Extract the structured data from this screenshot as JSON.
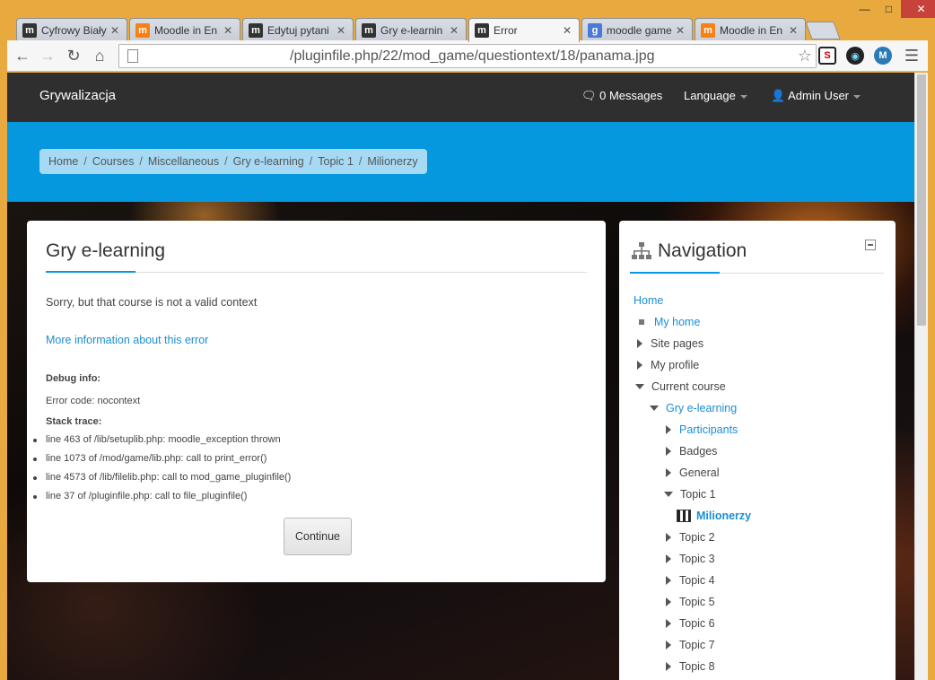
{
  "browser": {
    "tabs": [
      {
        "title": "Cyfrowy Biały",
        "favicon": "moodle-m-icon"
      },
      {
        "title": "Moodle in En",
        "favicon": "moodle-orange-icon"
      },
      {
        "title": "Edytuj pytani",
        "favicon": "moodle-m-icon"
      },
      {
        "title": "Gry e-learnin",
        "favicon": "moodle-m-icon"
      },
      {
        "title": "Error",
        "favicon": "moodle-m-icon",
        "active": true
      },
      {
        "title": "moodle game",
        "favicon": "google-icon"
      },
      {
        "title": "Moodle in En",
        "favicon": "moodle-orange-icon"
      }
    ],
    "tab_close": "✕",
    "url": "/pluginfile.php/22/mod_game/questiontext/18/panama.jpg"
  },
  "navbar": {
    "brand": "Grywalizacja",
    "messages": "0 Messages",
    "language": "Language",
    "user": "Admin User"
  },
  "breadcrumb": [
    "Home",
    "Courses",
    "Miscellaneous",
    "Gry e-learning",
    "Topic 1",
    "Milionerzy"
  ],
  "breadcrumb_sep": "/",
  "main": {
    "title": "Gry e-learning",
    "message": "Sorry, but that course is not a valid context",
    "more_info": "More information about this error",
    "debug_info_label": "Debug info:",
    "error_code": "Error code: nocontext",
    "stack_trace_label": "Stack trace:",
    "stack": [
      "line 463 of /lib/setuplib.php: moodle_exception thrown",
      "line 1073 of /mod/game/lib.php: call to print_error()",
      "line 4573 of /lib/filelib.php: call to mod_game_pluginfile()",
      "line 37 of /pluginfile.php: call to file_pluginfile()"
    ],
    "continue": "Continue"
  },
  "navigation": {
    "title": "Navigation",
    "items": [
      {
        "label": "Home",
        "style": "link"
      },
      {
        "label": "My home",
        "style": "link"
      },
      {
        "label": "Site pages",
        "style": "plain"
      },
      {
        "label": "My profile",
        "style": "plain"
      },
      {
        "label": "Current course",
        "style": "plain"
      },
      {
        "label": "Gry e-learning",
        "style": "link"
      },
      {
        "label": "Participants",
        "style": "link"
      },
      {
        "label": "Badges",
        "style": "plain"
      },
      {
        "label": "General",
        "style": "plain"
      },
      {
        "label": "Topic 1",
        "style": "plain"
      },
      {
        "label": "Milionerzy",
        "style": "link-bold"
      },
      {
        "label": "Topic 2",
        "style": "plain"
      },
      {
        "label": "Topic 3",
        "style": "plain"
      },
      {
        "label": "Topic 4",
        "style": "plain"
      },
      {
        "label": "Topic 5",
        "style": "plain"
      },
      {
        "label": "Topic 6",
        "style": "plain"
      },
      {
        "label": "Topic 7",
        "style": "plain"
      },
      {
        "label": "Topic 8",
        "style": "plain"
      }
    ]
  },
  "colors": {
    "accent": "#0698de",
    "link": "#1a8ed4",
    "navbar": "#2f2f2f"
  }
}
